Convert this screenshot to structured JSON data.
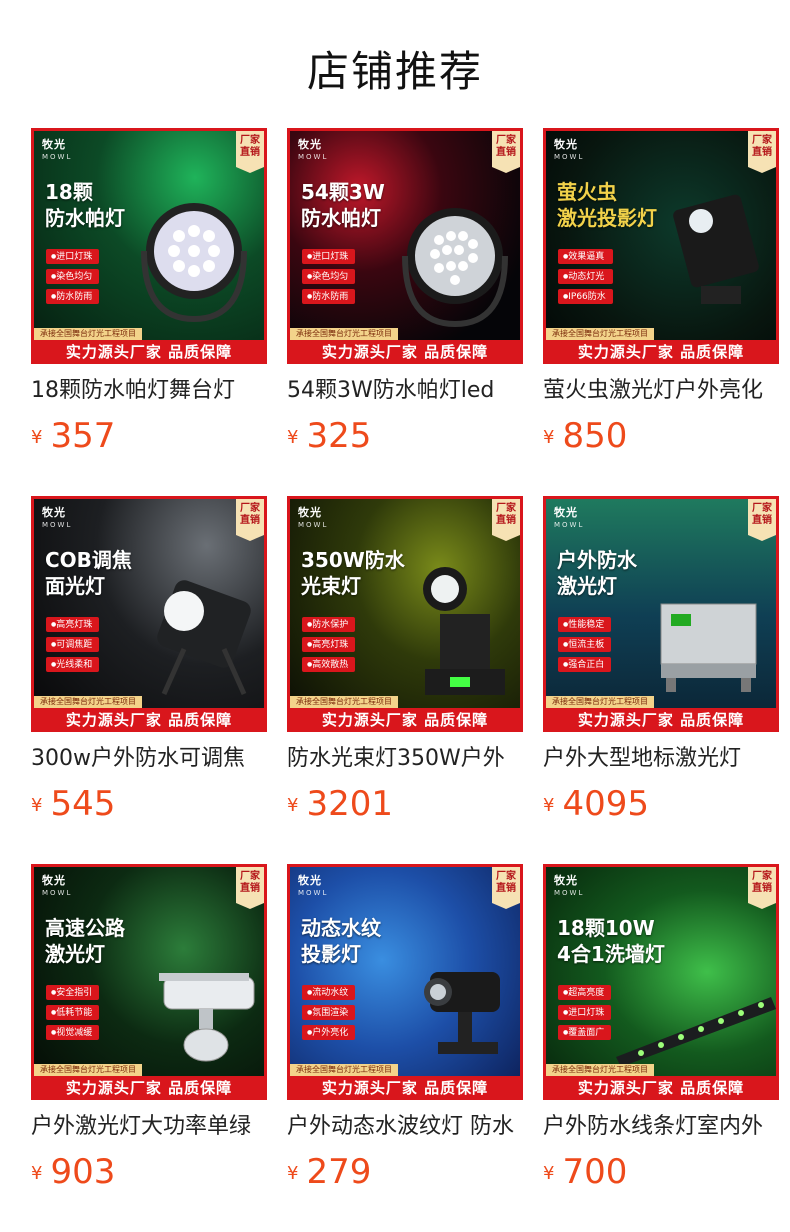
{
  "page": {
    "title": "店铺推荐"
  },
  "common": {
    "brand": "牧光",
    "brand_en": "MOWL",
    "corner_badge": "厂家直销",
    "strip_small": "承接全国舞台灯光工程项目",
    "strip_big": "实力源头厂家 品质保障",
    "currency": "¥"
  },
  "colors": {
    "accent_red": "#d9161c",
    "price_orange": "#ee4a1b"
  },
  "products": [
    {
      "headline_1": "18颗",
      "headline_2": "防水帕灯",
      "features": [
        "进口灯珠",
        "染色均匀",
        "防水防雨"
      ],
      "name": "18颗防水帕灯舞台灯",
      "price": "357",
      "device_icon": "par-light-icon"
    },
    {
      "headline_1": "54颗3W",
      "headline_2": "防水帕灯",
      "features": [
        "进口灯珠",
        "染色均匀",
        "防水防雨"
      ],
      "name": "54颗3W防水帕灯led",
      "price": "325",
      "device_icon": "par-light-icon"
    },
    {
      "headline_1": "萤火虫",
      "headline_2": "激光投影灯",
      "features": [
        "效果逼真",
        "动态灯光",
        "IP66防水"
      ],
      "name": "萤火虫激光灯户外亮化",
      "price": "850",
      "device_icon": "laser-projector-icon"
    },
    {
      "headline_1": "COB调焦",
      "headline_2": "面光灯",
      "features": [
        "高亮灯珠",
        "可调焦距",
        "光线柔和"
      ],
      "name": "300w户外防水可调焦",
      "price": "545",
      "device_icon": "spotlight-icon"
    },
    {
      "headline_1": "350W防水",
      "headline_2": "光束灯",
      "features": [
        "防水保护",
        "高亮灯珠",
        "高效散热"
      ],
      "name": "防水光束灯350W户外",
      "price": "3201",
      "device_icon": "beam-light-icon"
    },
    {
      "headline_1": "户外防水",
      "headline_2": "激光灯",
      "features": [
        "性能稳定",
        "恒流主板",
        "强合正白"
      ],
      "name": "户外大型地标激光灯",
      "price": "4095",
      "device_icon": "laser-box-icon"
    },
    {
      "headline_1": "高速公路",
      "headline_2": "激光灯",
      "features": [
        "安全指引",
        "低耗节能",
        "视觉减缓"
      ],
      "name": "户外激光灯大功率单绿",
      "price": "903",
      "device_icon": "camera-laser-icon"
    },
    {
      "headline_1": "动态水纹",
      "headline_2": "投影灯",
      "features": [
        "流动水纹",
        "氛围渲染",
        "户外亮化"
      ],
      "name": "户外动态水波纹灯 防水",
      "price": "279",
      "device_icon": "water-projector-icon"
    },
    {
      "headline_1": "18颗10W",
      "headline_2": "4合1洗墙灯",
      "features": [
        "超高亮度",
        "进口灯珠",
        "覆盖面广"
      ],
      "name": "户外防水线条灯室内外",
      "price": "700",
      "device_icon": "wall-washer-icon"
    }
  ]
}
